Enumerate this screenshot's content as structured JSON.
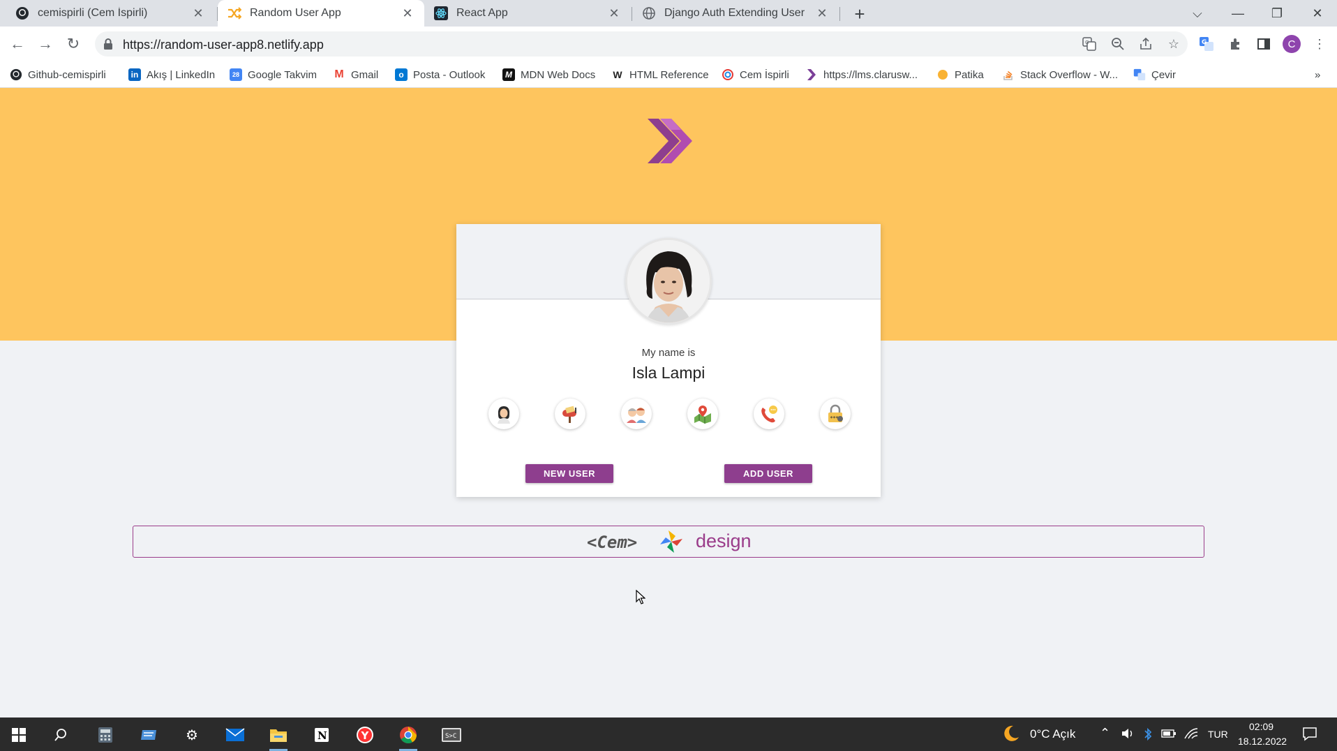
{
  "browser": {
    "tabs": [
      {
        "title": "cemispirli (Cem İspirli)",
        "icon": "github-icon",
        "active": false
      },
      {
        "title": "Random User App",
        "icon": "shuffle-icon",
        "active": true
      },
      {
        "title": "React App",
        "icon": "react-icon",
        "active": false
      },
      {
        "title": "Django Auth Extending User",
        "icon": "globe-icon",
        "active": false
      }
    ],
    "url": "https://random-user-app8.netlify.app",
    "profile_initial": "C",
    "bookmarks": [
      {
        "label": "Github-cemispirli",
        "icon": "github-icon"
      },
      {
        "label": "Akış | LinkedIn",
        "icon": "linkedin-icon"
      },
      {
        "label": "Google Takvim",
        "icon": "calendar-icon"
      },
      {
        "label": "Gmail",
        "icon": "gmail-icon"
      },
      {
        "label": "Posta - Outlook",
        "icon": "outlook-icon"
      },
      {
        "label": "MDN Web Docs",
        "icon": "mdn-icon"
      },
      {
        "label": "HTML Reference",
        "icon": "w3-icon"
      },
      {
        "label": "Cem İspirli",
        "icon": "swirl-icon"
      },
      {
        "label": "https://lms.clarusw...",
        "icon": "clarusway-icon"
      },
      {
        "label": "Patika",
        "icon": "patika-icon"
      },
      {
        "label": "Stack Overflow - W...",
        "icon": "stackoverflow-icon"
      },
      {
        "label": "Çevir",
        "icon": "translate-icon"
      }
    ]
  },
  "app": {
    "info_title": "My name is",
    "info_value": "Isla Lampi",
    "info_icons": [
      "woman-icon",
      "mailbox-icon",
      "age-icon",
      "map-icon",
      "phone-icon",
      "padlock-icon"
    ],
    "buttons": {
      "new_user": "NEW USER",
      "add_user": "ADD USER"
    },
    "footer": {
      "left": "<Cem>",
      "right": "design"
    },
    "colors": {
      "hero": "#fec55e",
      "accent": "#8e3e8e",
      "footer_border": "#9a3c8a"
    }
  },
  "taskbar": {
    "weather": "0°C Açık",
    "language": "TUR",
    "time": "02:09",
    "date": "18.12.2022"
  }
}
